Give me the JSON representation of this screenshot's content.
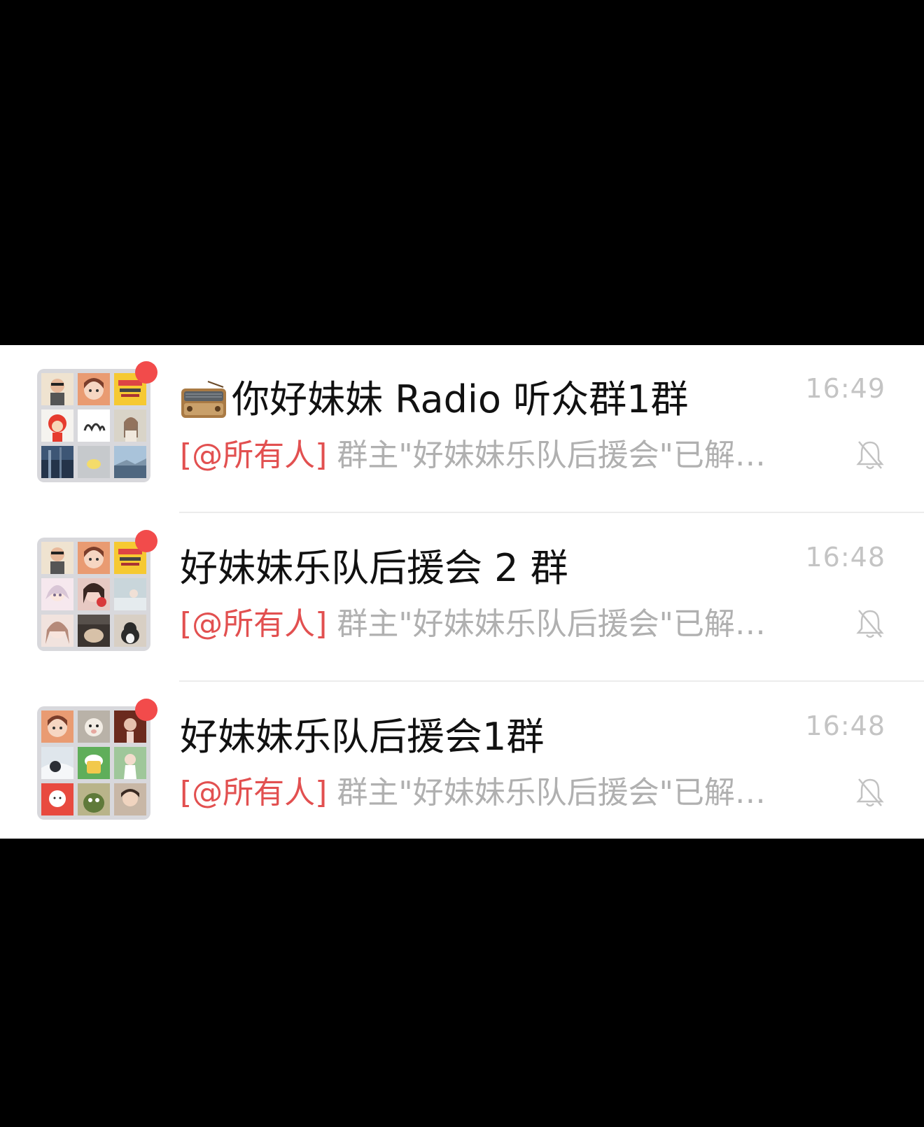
{
  "chats": [
    {
      "title": "你好妹妹 Radio 听众群1群",
      "title_icon": "radio-icon",
      "time": "16:49",
      "mention": "[@所有人]",
      "preview": "群主\"好妹妹乐队后援会\"已解…",
      "muted": true,
      "unread": true
    },
    {
      "title": "好妹妹乐队后援会 2 群",
      "time": "16:48",
      "mention": "[@所有人]",
      "preview": "群主\"好妹妹乐队后援会\"已解…",
      "muted": true,
      "unread": true
    },
    {
      "title": "好妹妹乐队后援会1群",
      "time": "16:48",
      "mention": "[@所有人]",
      "preview": "群主\"好妹妹乐队后援会\"已解…",
      "muted": true,
      "unread": true
    }
  ],
  "colors": {
    "unread_dot": "#f24b4b",
    "mention": "#e25050",
    "preview": "#b0b0b0",
    "time": "#c4c4c4",
    "title": "#111111"
  }
}
